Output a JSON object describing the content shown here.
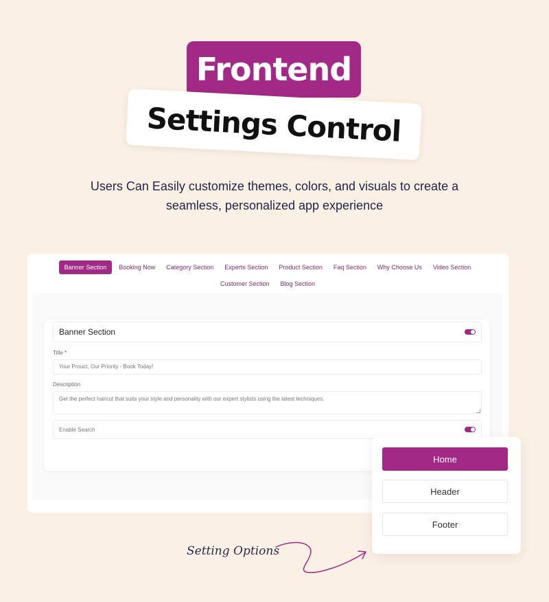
{
  "hero": {
    "badge": "Frontend",
    "card": "Settings Control",
    "subtitle_line1": "Users Can Easily customize themes, colors, and visuals to create a",
    "subtitle_line2": "seamless, personalized app experience"
  },
  "tabs": [
    {
      "label": "Banner Section",
      "active": true
    },
    {
      "label": "Booking Now"
    },
    {
      "label": "Category Section"
    },
    {
      "label": "Experts Section"
    },
    {
      "label": "Product Section"
    },
    {
      "label": "Faq Section"
    },
    {
      "label": "Why Choose Us"
    },
    {
      "label": "Video Section"
    },
    {
      "label": "Customer Section"
    },
    {
      "label": "Blog Section"
    }
  ],
  "form": {
    "section_title": "Banner Section",
    "section_enabled": true,
    "title_label": "Title",
    "required_mark": "*",
    "title_value": "Your Prouct, Our Priority - Book Today!",
    "description_label": "Description",
    "description_value": "Get the perfect haircut that suits your style and personality with our expert stylists using the latest techniques.",
    "enable_search_label": "Enable Search",
    "search_enabled": true
  },
  "options": {
    "items": [
      "Home",
      "Header",
      "Footer"
    ],
    "active": "Home"
  },
  "caption": "Setting Options",
  "colors": {
    "accent": "#a22a86",
    "background": "#fbf0e4"
  }
}
